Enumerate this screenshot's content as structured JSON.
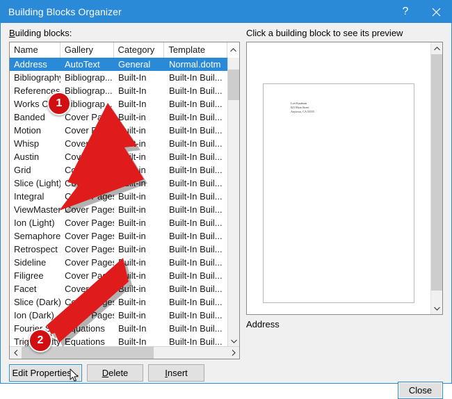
{
  "window": {
    "title": "Building Blocks Organizer",
    "help_icon": "question-mark-icon",
    "close_icon": "close-icon"
  },
  "left_panel": {
    "label": "Building blocks:",
    "columns": [
      "Name",
      "Gallery",
      "Category",
      "Template"
    ],
    "rows": [
      {
        "name": "Address",
        "gallery": "AutoText",
        "category": "General",
        "template": "Normal.dotm",
        "selected": true
      },
      {
        "name": "Bibliography",
        "gallery": "Bibliograp...",
        "category": "Built-In",
        "template": "Built-In Buil..."
      },
      {
        "name": "References",
        "gallery": "Bibliograp...",
        "category": "Built-In",
        "template": "Built-In Buil..."
      },
      {
        "name": "Works Cited",
        "gallery": "Bibliograp...",
        "category": "Built-In",
        "template": "Built-In Buil..."
      },
      {
        "name": "Banded",
        "gallery": "Cover Pages",
        "category": "Built-in",
        "template": "Built-In Buil..."
      },
      {
        "name": "Motion",
        "gallery": "Cover Pages",
        "category": "Built-in",
        "template": "Built-In Buil..."
      },
      {
        "name": "Whisp",
        "gallery": "Cover Pages",
        "category": "Built-in",
        "template": "Built-In Buil..."
      },
      {
        "name": "Austin",
        "gallery": "Cover Pages",
        "category": "Built-in",
        "template": "Built-In Buil..."
      },
      {
        "name": "Grid",
        "gallery": "Cover Pages",
        "category": "Built-in",
        "template": "Built-In Buil..."
      },
      {
        "name": "Slice (Light)",
        "gallery": "Cover Pages",
        "category": "Built-in",
        "template": "Built-In Buil..."
      },
      {
        "name": "Integral",
        "gallery": "Cover Pages",
        "category": "Built-in",
        "template": "Built-In Buil..."
      },
      {
        "name": "ViewMaster",
        "gallery": "Cover Pages",
        "category": "Built-in",
        "template": "Built-In Buil..."
      },
      {
        "name": "Ion (Light)",
        "gallery": "Cover Pages",
        "category": "Built-in",
        "template": "Built-In Buil..."
      },
      {
        "name": "Semaphore",
        "gallery": "Cover Pages",
        "category": "Built-in",
        "template": "Built-In Buil..."
      },
      {
        "name": "Retrospect",
        "gallery": "Cover Pages",
        "category": "Built-in",
        "template": "Built-In Buil..."
      },
      {
        "name": "Sideline",
        "gallery": "Cover Pages",
        "category": "Built-in",
        "template": "Built-In Buil..."
      },
      {
        "name": "Filigree",
        "gallery": "Cover Pages",
        "category": "Built-in",
        "template": "Built-In Buil..."
      },
      {
        "name": "Facet",
        "gallery": "Cover Pages",
        "category": "Built-in",
        "template": "Built-In Buil..."
      },
      {
        "name": "Slice (Dark)",
        "gallery": "Cover Pages",
        "category": "Built-in",
        "template": "Built-In Buil..."
      },
      {
        "name": "Ion (Dark)",
        "gallery": "Cover Pages",
        "category": "Built-in",
        "template": "Built-In Buil..."
      },
      {
        "name": "Fourier Series",
        "gallery": "Equations",
        "category": "Built-In",
        "template": "Built-In Buil..."
      },
      {
        "name": "Trig Identity",
        "gallery": "Equations",
        "category": "Built-In",
        "template": "Built-In Buil..."
      }
    ]
  },
  "right_panel": {
    "label": "Click a building block to see its preview",
    "caption": "Address",
    "document_preview": {
      "line1": "Lori Kaufman",
      "line2": "821 Main Street",
      "line3": "Anytown, CA 55555"
    }
  },
  "buttons": {
    "edit_properties": "Edit Properties...",
    "delete": "Delete",
    "insert": "Insert",
    "close": "Close"
  },
  "annotations": {
    "badge_one": "1",
    "badge_two": "2",
    "arrow_color": "#e01b1b",
    "badge_color": "#d10f12"
  },
  "theme": {
    "title_bar": "#2b8ad8",
    "selection": "#2b8ad8",
    "dialog_background": "#f0f0f0",
    "focus_border": "#2a8ad4"
  }
}
